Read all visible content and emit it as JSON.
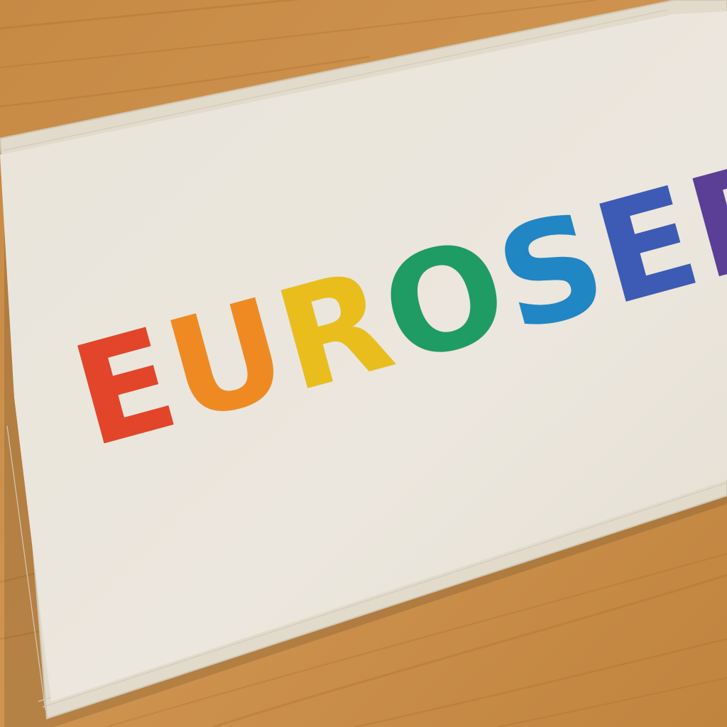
{
  "scene": {
    "description_colors": {
      "floor_wood": "#c98d44",
      "floor_wood_dark": "#b57833",
      "mat_surface": "#ebe6dc",
      "mat_binding": "#e4ddcf"
    }
  },
  "mat": {
    "letters": [
      {
        "char": "E",
        "color": "#e2452a"
      },
      {
        "char": "U",
        "color": "#ef8a22"
      },
      {
        "char": "R",
        "color": "#e9be1c"
      },
      {
        "char": "O",
        "color": "#1f9b64"
      },
      {
        "char": "S",
        "color": "#2186c4"
      },
      {
        "char": "E",
        "color": "#3d5ab4"
      },
      {
        "char": "R",
        "color": "#5b3e96"
      }
    ]
  }
}
